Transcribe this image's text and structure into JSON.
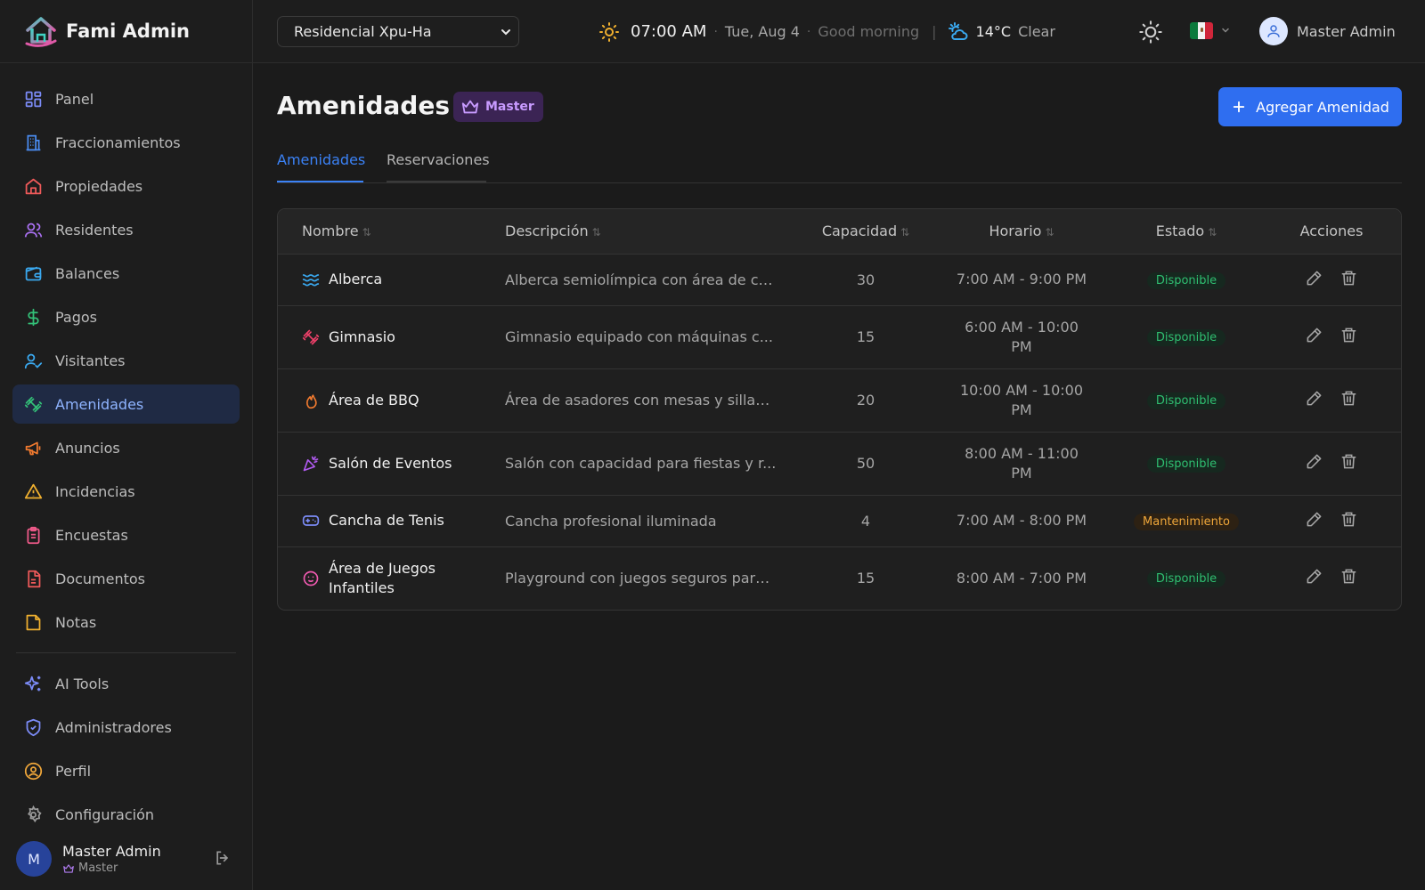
{
  "app": {
    "name": "Fami Admin"
  },
  "sidebar": {
    "items": [
      {
        "label": "Panel",
        "icon": "grid-icon",
        "color": "#7c8cf8"
      },
      {
        "label": "Fraccionamientos",
        "icon": "building-icon",
        "color": "#4a8cf0"
      },
      {
        "label": "Propiedades",
        "icon": "home-icon",
        "color": "#f05a5a"
      },
      {
        "label": "Residentes",
        "icon": "users-icon",
        "color": "#a970f0"
      },
      {
        "label": "Balances",
        "icon": "wallet-icon",
        "color": "#3aa9f0"
      },
      {
        "label": "Pagos",
        "icon": "dollar-icon",
        "color": "#33c178"
      },
      {
        "label": "Visitantes",
        "icon": "user-check-icon",
        "color": "#3aa9f0"
      },
      {
        "label": "Amenidades",
        "icon": "dumbbell-icon",
        "color": "#33c178",
        "active": true
      },
      {
        "label": "Anuncios",
        "icon": "megaphone-icon",
        "color": "#f07a2f"
      },
      {
        "label": "Incidencias",
        "icon": "alert-triangle-icon",
        "color": "#f0b02f"
      },
      {
        "label": "Encuestas",
        "icon": "clipboard-icon",
        "color": "#f05a8a"
      },
      {
        "label": "Documentos",
        "icon": "file-text-icon",
        "color": "#f05a5a"
      },
      {
        "label": "Notas",
        "icon": "note-icon",
        "color": "#f0b02f"
      }
    ],
    "secondary": [
      {
        "label": "AI Tools",
        "icon": "sparkles-icon",
        "color": "#7c8cf8"
      },
      {
        "label": "Administradores",
        "icon": "shield-icon",
        "color": "#7c8cf8"
      },
      {
        "label": "Perfil",
        "icon": "user-circle-icon",
        "color": "#f0a73a"
      },
      {
        "label": "Configuración",
        "icon": "gear-icon",
        "color": "#9a9a9a"
      }
    ],
    "user": {
      "initial": "M",
      "name": "Master Admin",
      "role": "Master"
    }
  },
  "topbar": {
    "community": "Residencial Xpu-Ha",
    "time": "07:00 AM",
    "date": "Tue, Aug 4",
    "greeting": "Good morning",
    "temp": "14°C",
    "condition": "Clear",
    "user_name": "Master Admin"
  },
  "page": {
    "title": "Amenidades",
    "badge": "Master",
    "add_button": "Agregar Amenidad",
    "tabs": [
      "Amenidades",
      "Reservaciones"
    ]
  },
  "table": {
    "headers": [
      "Nombre",
      "Descripción",
      "Capacidad",
      "Horario",
      "Estado",
      "Acciones"
    ],
    "rows": [
      {
        "name": "Alberca",
        "icon": "waves-icon",
        "desc": "Alberca semiolímpica con área de ch...",
        "cap": "30",
        "hours": "7:00 AM - 9:00 PM",
        "status": "Disponible"
      },
      {
        "name": "Gimnasio",
        "icon": "dumbbell-icon",
        "desc": "Gimnasio equipado con máquinas c...",
        "cap": "15",
        "hours": "6:00 AM - 10:00 PM",
        "status": "Disponible"
      },
      {
        "name": "Área de BBQ",
        "icon": "flame-icon",
        "desc": "Área de asadores con mesas y sillas ...",
        "cap": "20",
        "hours": "10:00 AM - 10:00 PM",
        "status": "Disponible"
      },
      {
        "name": "Salón de Eventos",
        "icon": "party-popper-icon",
        "desc": "Salón con capacidad para fiestas y r...",
        "cap": "50",
        "hours": "8:00 AM - 11:00 PM",
        "status": "Disponible"
      },
      {
        "name": "Cancha de Tenis",
        "icon": "gamepad-icon",
        "desc": "Cancha profesional iluminada",
        "cap": "4",
        "hours": "7:00 AM - 8:00 PM",
        "status": "Mantenimiento"
      },
      {
        "name": "Área de Juegos Infantiles",
        "icon": "baby-icon",
        "desc": "Playground con juegos seguros para...",
        "cap": "15",
        "hours": "8:00 AM - 7:00 PM",
        "status": "Disponible"
      }
    ]
  }
}
